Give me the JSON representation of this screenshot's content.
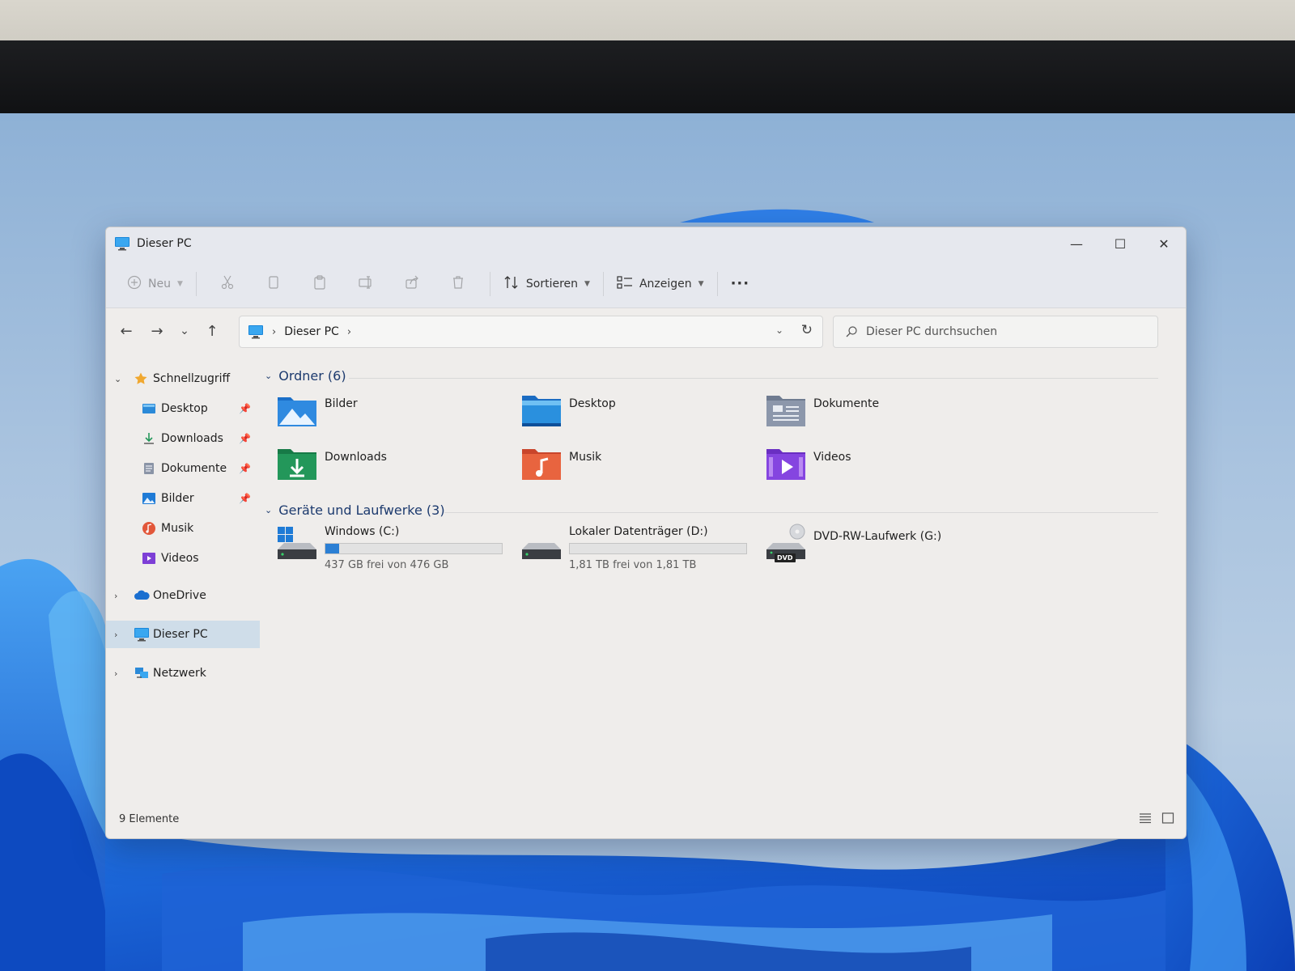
{
  "window": {
    "title": "Dieser PC"
  },
  "controls": {
    "minimize": "—",
    "maximize": "☐",
    "close": "✕"
  },
  "commandbar": {
    "new_label": "Neu",
    "sort_label": "Sortieren",
    "view_label": "Anzeigen",
    "more_label": "···"
  },
  "nav": {
    "back": "←",
    "forward": "→",
    "recent": "⌄",
    "up": "↑",
    "address_crumb": "Dieser PC",
    "search_placeholder": "Dieser PC durchsuchen"
  },
  "sidebar": {
    "quick_access": "Schnellzugriff",
    "items": [
      {
        "label": "Desktop",
        "pinned": true
      },
      {
        "label": "Downloads",
        "pinned": true
      },
      {
        "label": "Dokumente",
        "pinned": true
      },
      {
        "label": "Bilder",
        "pinned": true
      },
      {
        "label": "Musik",
        "pinned": false
      },
      {
        "label": "Videos",
        "pinned": false
      }
    ],
    "onedrive": "OneDrive",
    "this_pc": "Dieser PC",
    "network": "Netzwerk"
  },
  "folders": {
    "header": "Ordner (6)",
    "items": [
      {
        "name": "Bilder"
      },
      {
        "name": "Desktop"
      },
      {
        "name": "Dokumente"
      },
      {
        "name": "Downloads"
      },
      {
        "name": "Musik"
      },
      {
        "name": "Videos"
      }
    ]
  },
  "drives": {
    "header": "Geräte und Laufwerke (3)",
    "items": [
      {
        "name": "Windows (C:)",
        "free": "437 GB frei von 476 GB",
        "used_fraction": 0.08
      },
      {
        "name": "Lokaler Datenträger (D:)",
        "free": "1,81 TB frei von 1,81 TB",
        "used_fraction": 0.0
      },
      {
        "name": "DVD-RW-Laufwerk (G:)",
        "dvd_label": "DVD"
      }
    ]
  },
  "status": {
    "count": "9 Elemente"
  },
  "colors": {
    "accent": "#2b7fd4",
    "selection": "#cfdde9",
    "header_text": "#1c3a6e"
  }
}
